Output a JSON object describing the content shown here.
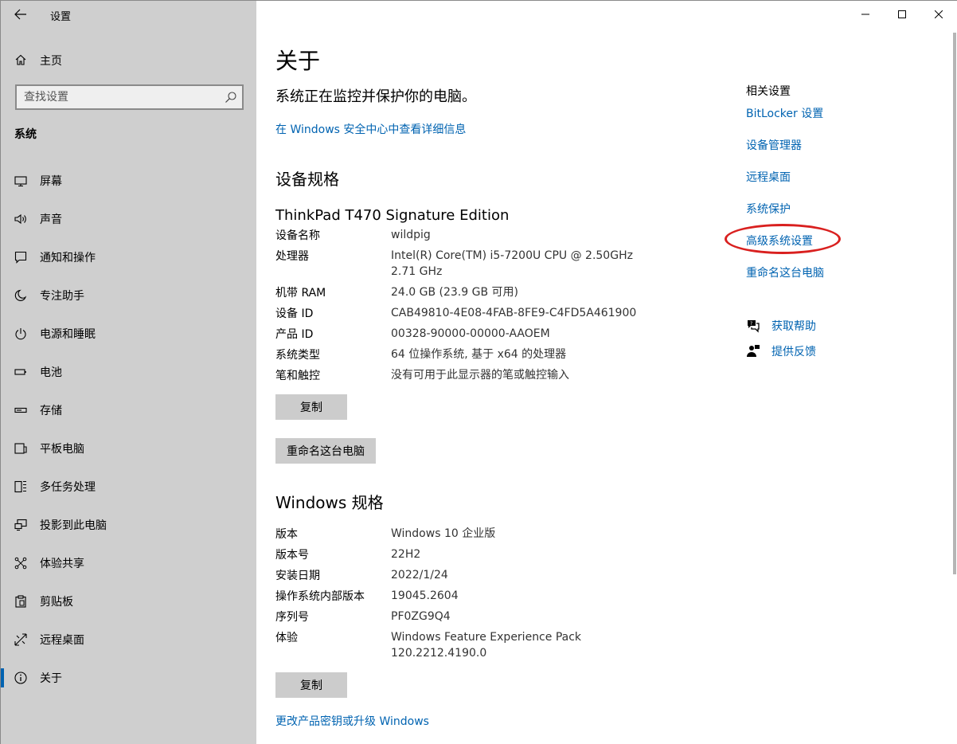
{
  "titlebar": {
    "app_title": "设置"
  },
  "sidebar": {
    "home_label": "主页",
    "search_placeholder": "查找设置",
    "section_title": "系统",
    "items": [
      {
        "label": "屏幕",
        "icon": "display-icon"
      },
      {
        "label": "声音",
        "icon": "speaker-icon"
      },
      {
        "label": "通知和操作",
        "icon": "notification-icon"
      },
      {
        "label": "专注助手",
        "icon": "moon-icon"
      },
      {
        "label": "电源和睡眠",
        "icon": "power-icon"
      },
      {
        "label": "电池",
        "icon": "battery-icon"
      },
      {
        "label": "存储",
        "icon": "storage-icon"
      },
      {
        "label": "平板电脑",
        "icon": "tablet-icon"
      },
      {
        "label": "多任务处理",
        "icon": "multitask-icon"
      },
      {
        "label": "投影到此电脑",
        "icon": "project-icon"
      },
      {
        "label": "体验共享",
        "icon": "share-icon"
      },
      {
        "label": "剪贴板",
        "icon": "clipboard-icon"
      },
      {
        "label": "远程桌面",
        "icon": "remote-icon"
      },
      {
        "label": "关于",
        "icon": "info-icon",
        "active": true
      }
    ]
  },
  "main": {
    "title": "关于",
    "protect_text": "系统正在监控并保护你的电脑。",
    "security_link": "在 Windows 安全中心中查看详细信息",
    "device_spec_heading": "设备规格",
    "device_model": "ThinkPad T470 Signature Edition",
    "device_specs": [
      {
        "key": "设备名称",
        "value": "wildpig"
      },
      {
        "key": "处理器",
        "value": "Intel(R) Core(TM) i5-7200U CPU @ 2.50GHz",
        "value2": "2.71 GHz"
      },
      {
        "key": "机带 RAM",
        "value": "24.0 GB (23.9 GB 可用)"
      },
      {
        "key": "设备 ID",
        "value": "CAB49810-4E08-4FAB-8FE9-C4FD5A461900"
      },
      {
        "key": "产品 ID",
        "value": "00328-90000-00000-AAOEM"
      },
      {
        "key": "系统类型",
        "value": "64 位操作系统, 基于 x64 的处理器"
      },
      {
        "key": "笔和触控",
        "value": "没有可用于此显示器的笔或触控输入"
      }
    ],
    "copy_label": "复制",
    "rename_label": "重命名这台电脑",
    "windows_spec_heading": "Windows 规格",
    "windows_specs": [
      {
        "key": "版本",
        "value": "Windows 10 企业版"
      },
      {
        "key": "版本号",
        "value": "22H2"
      },
      {
        "key": "安装日期",
        "value": "2022/1/24"
      },
      {
        "key": "操作系统内部版本",
        "value": "19045.2604"
      },
      {
        "key": "序列号",
        "value": "PF0ZG9Q4"
      },
      {
        "key": "体验",
        "value": "Windows Feature Experience Pack",
        "value2": "120.2212.4190.0"
      }
    ],
    "copy2_label": "复制",
    "upgrade_link": "更改产品密钥或升级 Windows"
  },
  "related": {
    "title": "相关设置",
    "links": [
      "BitLocker 设置",
      "设备管理器",
      "远程桌面",
      "系统保护",
      "高级系统设置",
      "重命名这台电脑"
    ],
    "help_label": "获取帮助",
    "feedback_label": "提供反馈"
  },
  "colors": {
    "accent": "#0063b1",
    "sidebar_bg": "#cfcfcf",
    "highlight": "#d9201f"
  }
}
